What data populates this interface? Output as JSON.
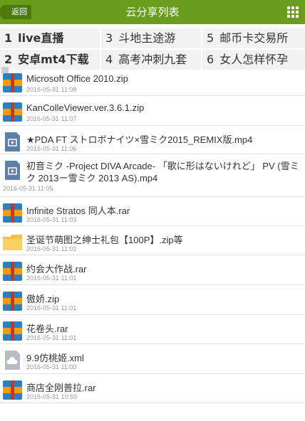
{
  "header": {
    "back_label": "返回",
    "title": "云分享列表",
    "menu_icon": "grid-icon",
    "color": "#6a9c1b"
  },
  "hot_searches": [
    [
      {
        "rank": "1",
        "text": "live直播",
        "bold": true
      },
      {
        "rank": "3",
        "text": "斗地主途游",
        "bold": false
      },
      {
        "rank": "5",
        "text": "邮币卡交易所",
        "bold": false
      }
    ],
    [
      {
        "rank": "2",
        "text": "安卓mt4下载",
        "bold": true
      },
      {
        "rank": "4",
        "text": "高考冲刺九套",
        "bold": false
      },
      {
        "rank": "6",
        "text": "女人怎样怀孕",
        "bold": false
      }
    ]
  ],
  "files": [
    {
      "name": "Microsoft Office 2010.zip",
      "date": "2016-05-31 11:08",
      "icon": "archive-icon"
    },
    {
      "name": "KanColleViewer.ver.3.6.1.zip",
      "date": "2016-05-31 11:07",
      "icon": "archive-icon"
    },
    {
      "name": "★PDA FT ストロボナイツ×雪ミク2015_REMIX版.mp4",
      "date": "2016-05-31 11:06",
      "icon": "video-icon"
    },
    {
      "name": "初音ミク -Project DIVA Arcade- 「歌に形はないけれど」 PV (雪ミク 2013ー雪ミク 2013 AS).mp4",
      "date": "2016-05-31 11:05",
      "icon": "video-icon"
    },
    {
      "name": "Infinite Stratos 同人本.rar",
      "date": "2016-05-31 11:03",
      "icon": "archive-icon"
    },
    {
      "name": "圣诞节萌图之绅士礼包【100P】.zip等",
      "date": "2016-05-31 11:02",
      "icon": "folder-icon"
    },
    {
      "name": "约会大作战.rar",
      "date": "2016-05-31 11:01",
      "icon": "archive-icon"
    },
    {
      "name": "傲娇.zip",
      "date": "2016-05-31 11:01",
      "icon": "archive-icon"
    },
    {
      "name": "花卷头.rar",
      "date": "2016-05-31 11:01",
      "icon": "archive-icon"
    },
    {
      "name": "9.9仿桃姬.xml",
      "date": "2016-05-31 11:00",
      "icon": "cloud-file-icon"
    },
    {
      "name": "商店全刚普拉.rar",
      "date": "2016-05-31 10:59",
      "icon": "archive-icon"
    }
  ]
}
